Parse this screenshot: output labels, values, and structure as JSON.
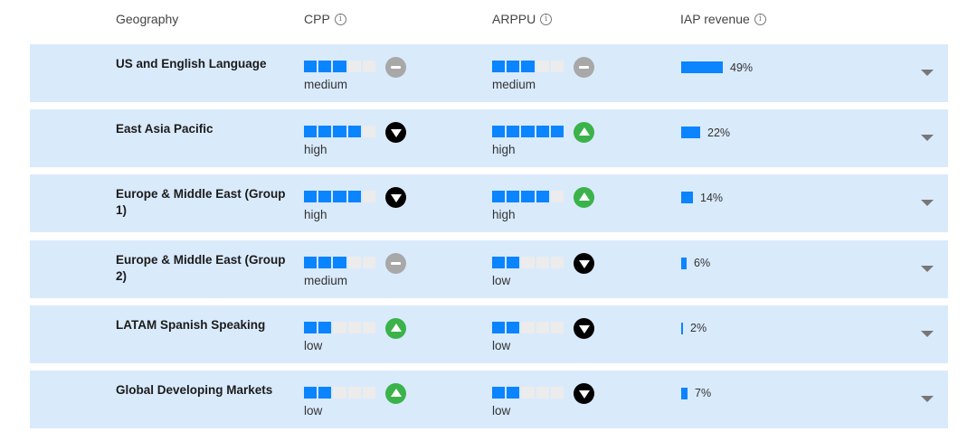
{
  "header": {
    "geography": "Geography",
    "cpp": "CPP",
    "arppu": "ARPPU",
    "iap": "IAP revenue",
    "info_icon_glyph": "i"
  },
  "colors": {
    "row_bg": "#d9eafb",
    "bar_on": "#0a84ff",
    "bar_off": "#ececec",
    "trend_up": "#3bb34a",
    "trend_down": "#000000",
    "trend_neutral": "#a8a8a8"
  },
  "rows": [
    {
      "geo": "US and English Language",
      "cpp": {
        "filled": 3,
        "total": 5,
        "label": "medium",
        "trend": "neutral"
      },
      "arppu": {
        "filled": 3,
        "total": 5,
        "label": "medium",
        "trend": "neutral"
      },
      "iap": {
        "percent": 49,
        "text": "49%"
      }
    },
    {
      "geo": "East Asia Pacific",
      "cpp": {
        "filled": 4,
        "total": 5,
        "label": "high",
        "trend": "down"
      },
      "arppu": {
        "filled": 5,
        "total": 5,
        "label": "high",
        "trend": "up"
      },
      "iap": {
        "percent": 22,
        "text": "22%"
      }
    },
    {
      "geo": "Europe & Middle East (Group 1)",
      "cpp": {
        "filled": 4,
        "total": 5,
        "label": "high",
        "trend": "down"
      },
      "arppu": {
        "filled": 4,
        "total": 5,
        "label": "high",
        "trend": "up"
      },
      "iap": {
        "percent": 14,
        "text": "14%"
      }
    },
    {
      "geo": "Europe & Middle East (Group 2)",
      "cpp": {
        "filled": 3,
        "total": 5,
        "label": "medium",
        "trend": "neutral"
      },
      "arppu": {
        "filled": 2,
        "total": 5,
        "label": "low",
        "trend": "down"
      },
      "iap": {
        "percent": 6,
        "text": "6%"
      }
    },
    {
      "geo": "LATAM Spanish Speaking",
      "cpp": {
        "filled": 2,
        "total": 5,
        "label": "low",
        "trend": "up"
      },
      "arppu": {
        "filled": 2,
        "total": 5,
        "label": "low",
        "trend": "down"
      },
      "iap": {
        "percent": 2,
        "text": "2%"
      }
    },
    {
      "geo": "Global Developing Markets",
      "cpp": {
        "filled": 2,
        "total": 5,
        "label": "low",
        "trend": "up"
      },
      "arppu": {
        "filled": 2,
        "total": 5,
        "label": "low",
        "trend": "down"
      },
      "iap": {
        "percent": 7,
        "text": "7%"
      }
    }
  ]
}
